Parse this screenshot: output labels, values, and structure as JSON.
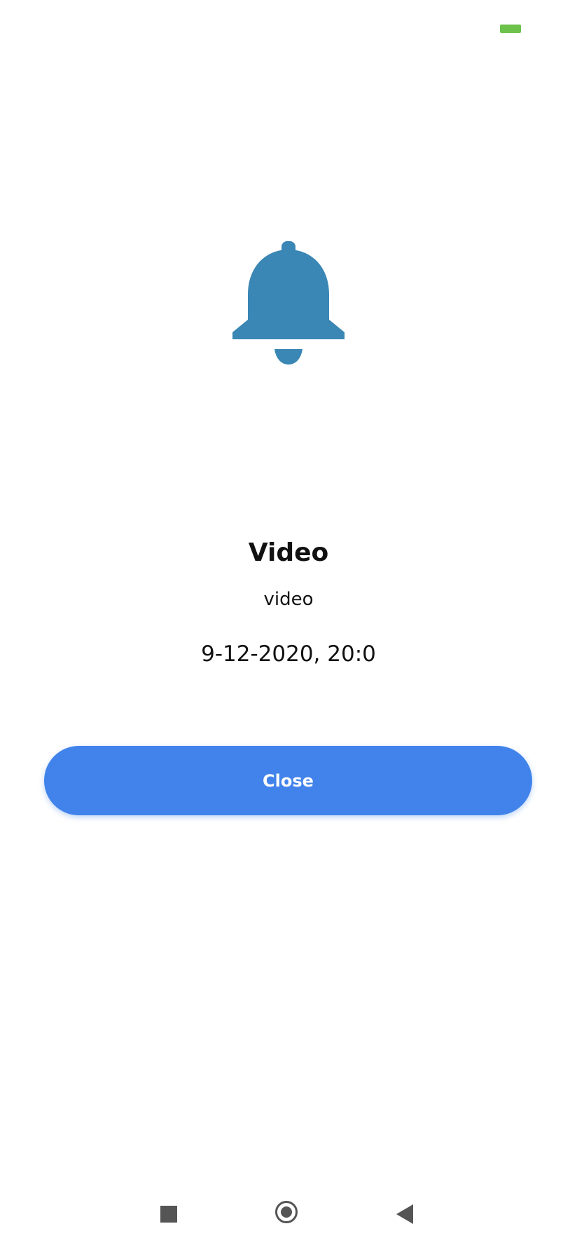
{
  "status_bar": {
    "battery_icon": "battery-icon",
    "battery_color": "#6cc24a"
  },
  "alert": {
    "icon": "bell-icon",
    "icon_color": "#3a86b4",
    "title": "Video",
    "subtitle": "video",
    "datetime": "9-12-2020, 20:0",
    "close_label": "Close",
    "button_color": "#4183ea"
  },
  "nav_bar": {
    "recents_icon": "square-icon",
    "home_icon": "circle-icon",
    "back_icon": "triangle-back-icon"
  }
}
